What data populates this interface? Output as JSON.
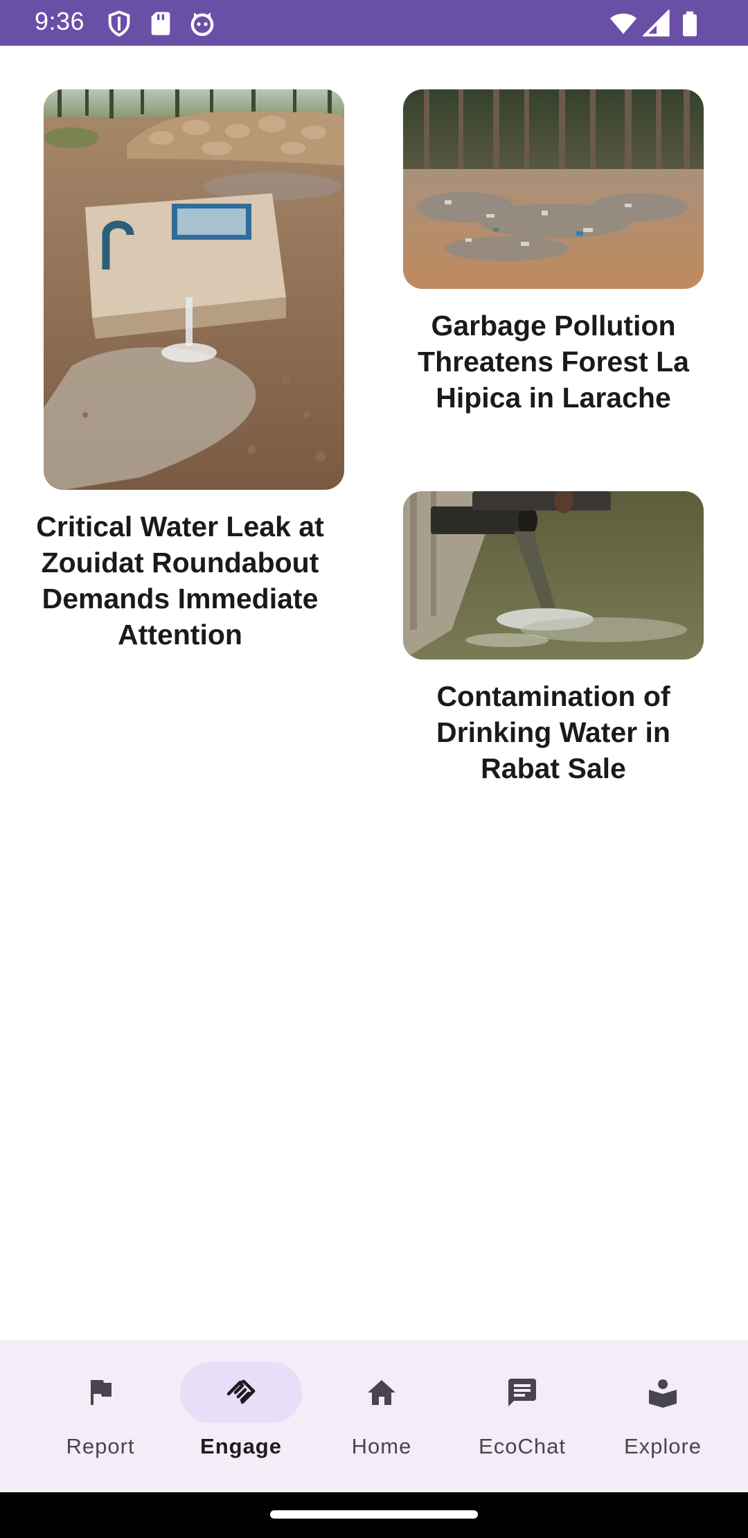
{
  "status_bar": {
    "time": "9:36",
    "background_color": "#6a4fa6",
    "left_icons": [
      "shield-icon",
      "sd-card-icon",
      "cat-face-icon"
    ],
    "right_icons": [
      "wifi-icon",
      "signal-icon",
      "battery-icon"
    ]
  },
  "reports": [
    {
      "title": "Critical Water Leak at Zouidat Roundabout Demands Immediate Attention",
      "image": "water-leak-photo"
    },
    {
      "title": "Garbage Pollution Threatens Forest La Hipica in Larache",
      "image": "forest-garbage-photo"
    },
    {
      "title": "Contamination of Drinking Water in Rabat Sale",
      "image": "sewage-pipe-photo"
    }
  ],
  "bottom_nav": {
    "items": [
      {
        "label": "Report",
        "icon": "flag-icon",
        "active": false
      },
      {
        "label": "Engage",
        "icon": "handshake-icon",
        "active": true
      },
      {
        "label": "Home",
        "icon": "home-icon",
        "active": false
      },
      {
        "label": "EcoChat",
        "icon": "chat-icon",
        "active": false
      },
      {
        "label": "Explore",
        "icon": "explore-book-icon",
        "active": false
      }
    ],
    "active_pill_color": "#e8def8",
    "background_color": "#f3edf7"
  }
}
